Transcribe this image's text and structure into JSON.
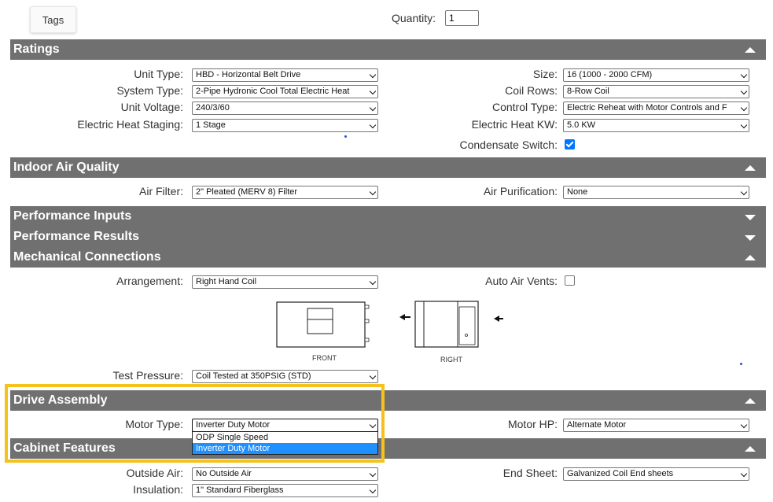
{
  "top": {
    "tags_label": "Tags",
    "quantity_label": "Quantity:",
    "quantity_value": "1"
  },
  "sections": {
    "ratings": "Ratings",
    "indoor_air_quality": "Indoor Air Quality",
    "performance_inputs": "Performance Inputs",
    "performance_results": "Performance Results",
    "mechanical_connections": "Mechanical Connections",
    "drive_assembly": "Drive Assembly",
    "cabinet_features": "Cabinet Features"
  },
  "ratings": {
    "unit_type": {
      "label": "Unit Type:",
      "value": "HBD - Horizontal Belt Drive"
    },
    "system_type": {
      "label": "System Type:",
      "value": "2-Pipe Hydronic Cool Total Electric Heat"
    },
    "unit_voltage": {
      "label": "Unit Voltage:",
      "value": "240/3/60"
    },
    "electric_heat_staging": {
      "label": "Electric Heat Staging:",
      "value": "1 Stage"
    },
    "size": {
      "label": "Size:",
      "value": "16 (1000 - 2000 CFM)"
    },
    "coil_rows": {
      "label": "Coil Rows:",
      "value": "8-Row Coil"
    },
    "control_type": {
      "label": "Control Type:",
      "value": "Electric Reheat with Motor Controls and F"
    },
    "electric_heat_kw": {
      "label": "Electric Heat KW:",
      "value": "5.0 KW"
    },
    "condensate_switch": {
      "label": "Condensate Switch:",
      "checked": true
    }
  },
  "iaq": {
    "air_filter": {
      "label": "Air Filter:",
      "value": "2\" Pleated (MERV 8) Filter"
    },
    "air_purification": {
      "label": "Air Purification:",
      "value": "None"
    }
  },
  "mechanical": {
    "arrangement": {
      "label": "Arrangement:",
      "value": "Right Hand Coil"
    },
    "auto_air_vents": {
      "label": "Auto Air Vents:",
      "checked": false
    },
    "front_caption": "FRONT",
    "right_caption": "RIGHT",
    "test_pressure": {
      "label": "Test Pressure:",
      "value": "Coil Tested at 350PSIG (STD)"
    }
  },
  "drive": {
    "motor_type": {
      "label": "Motor Type:",
      "value": "Inverter Duty Motor",
      "options": [
        "ODP Single Speed",
        "Inverter Duty Motor"
      ]
    },
    "motor_hp": {
      "label": "Motor HP:",
      "value": "Alternate Motor"
    }
  },
  "cabinet": {
    "outside_air": {
      "label": "Outside Air:",
      "value": "No Outside Air"
    },
    "insulation": {
      "label": "Insulation:",
      "value": "1\" Standard Fiberglass"
    },
    "end_sheet": {
      "label": "End Sheet:",
      "value": "Galvanized Coil End sheets"
    }
  },
  "colors": {
    "section_bar": "#707070",
    "checkbox_on": "#0075ff",
    "highlight": "#f5c21b",
    "option_selected": "#1e90ff"
  },
  "icons": [
    "collapse-triangle-up",
    "expand-triangle-down",
    "dropdown-caret"
  ]
}
